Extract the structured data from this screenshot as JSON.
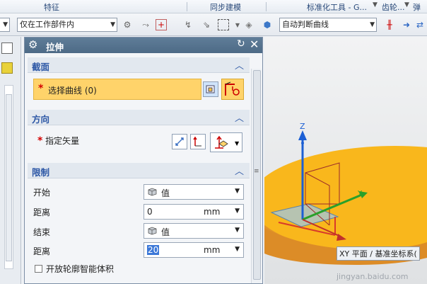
{
  "ribbon": {
    "groups": [
      "特征",
      "同步建模",
      "标准化工具 - G...",
      "齿轮...",
      "弹"
    ]
  },
  "toolbar": {
    "filter_combo": "仅在工作部件内",
    "curve_rule_combo": "自动判断曲线"
  },
  "dialog": {
    "title": "拉伸",
    "section": {
      "label": "截面",
      "select_curve": "选择曲线 (0)"
    },
    "direction": {
      "label": "方向",
      "specify_vector": "指定矢量"
    },
    "limits": {
      "label": "限制",
      "start_label": "开始",
      "start_value": "值",
      "distance1_label": "距离",
      "distance1_value": "0",
      "distance1_unit": "mm",
      "end_label": "结束",
      "end_value": "值",
      "distance2_label": "距离",
      "distance2_value": "20",
      "distance2_unit": "mm",
      "open_profile_label": "开放轮廓智能体积"
    }
  },
  "viewport": {
    "axis_z": "Z",
    "axis_y": "Y",
    "coord_label": "XY 平面 / 基准坐标系(",
    "watermark": "jingyan.baidu.com"
  },
  "colors": {
    "title_bar": "#516f8b",
    "section_header_text": "#2b56a5",
    "selection_highlight": "#ffd36a",
    "disk_top": "#f9b71c",
    "disk_side": "#e1932a"
  }
}
